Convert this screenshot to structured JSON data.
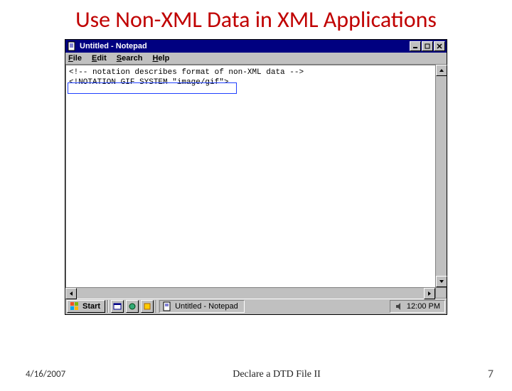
{
  "slide": {
    "title": "Use Non-XML Data  in XML Applications"
  },
  "notepad": {
    "window_title": "Untitled - Notepad",
    "menu": {
      "file": "File",
      "edit": "Edit",
      "search": "Search",
      "help": "Help"
    },
    "lines": {
      "l1": "<!-- notation describes format of non-XML data -->",
      "l2": "",
      "l3": "<!NOTATION GIF SYSTEM \"image/gif\">"
    }
  },
  "taskbar": {
    "start": "Start",
    "task_label": "Untitled - Notepad",
    "clock": "12:00 PM"
  },
  "footer": {
    "date": "4/16/2007",
    "center": "Declare a DTD File II",
    "page": "7"
  }
}
